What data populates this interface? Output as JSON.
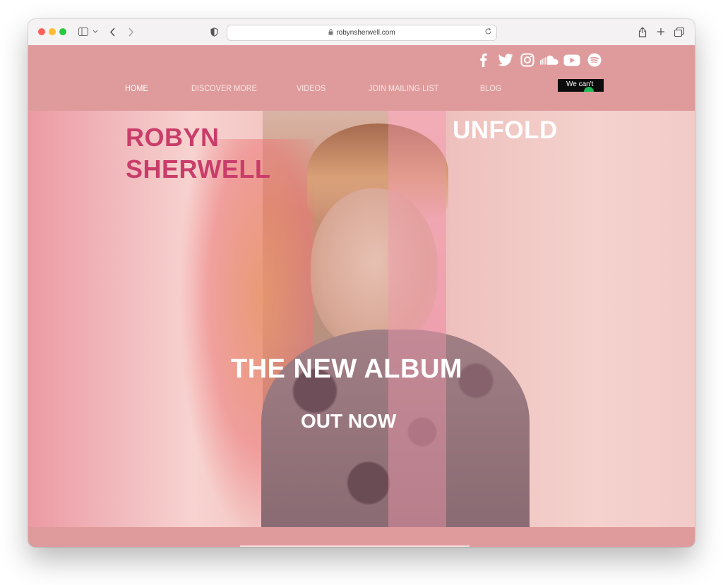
{
  "browser": {
    "url": "robynsherwell.com"
  },
  "social": [
    {
      "name": "facebook-icon"
    },
    {
      "name": "twitter-icon"
    },
    {
      "name": "instagram-icon"
    },
    {
      "name": "soundcloud-icon"
    },
    {
      "name": "youtube-icon"
    },
    {
      "name": "spotify-icon"
    }
  ],
  "nav": {
    "items": [
      {
        "label": "HOME",
        "active": true
      },
      {
        "label": "DISCOVER MORE"
      },
      {
        "label": "VIDEOS"
      },
      {
        "label": "JOIN MAILING LIST"
      },
      {
        "label": "BLOG"
      }
    ]
  },
  "player": {
    "text": "We can't"
  },
  "hero": {
    "artist_line1": "ROBYN",
    "artist_line2": "SHERWELL",
    "album": "UNFOLD",
    "headline": "THE NEW ALBUM",
    "subheadline": "OUT NOW"
  },
  "colors": {
    "header_bg": "#df9b9c",
    "brand_pink": "#c93d6a",
    "text_white": "#ffffff"
  }
}
